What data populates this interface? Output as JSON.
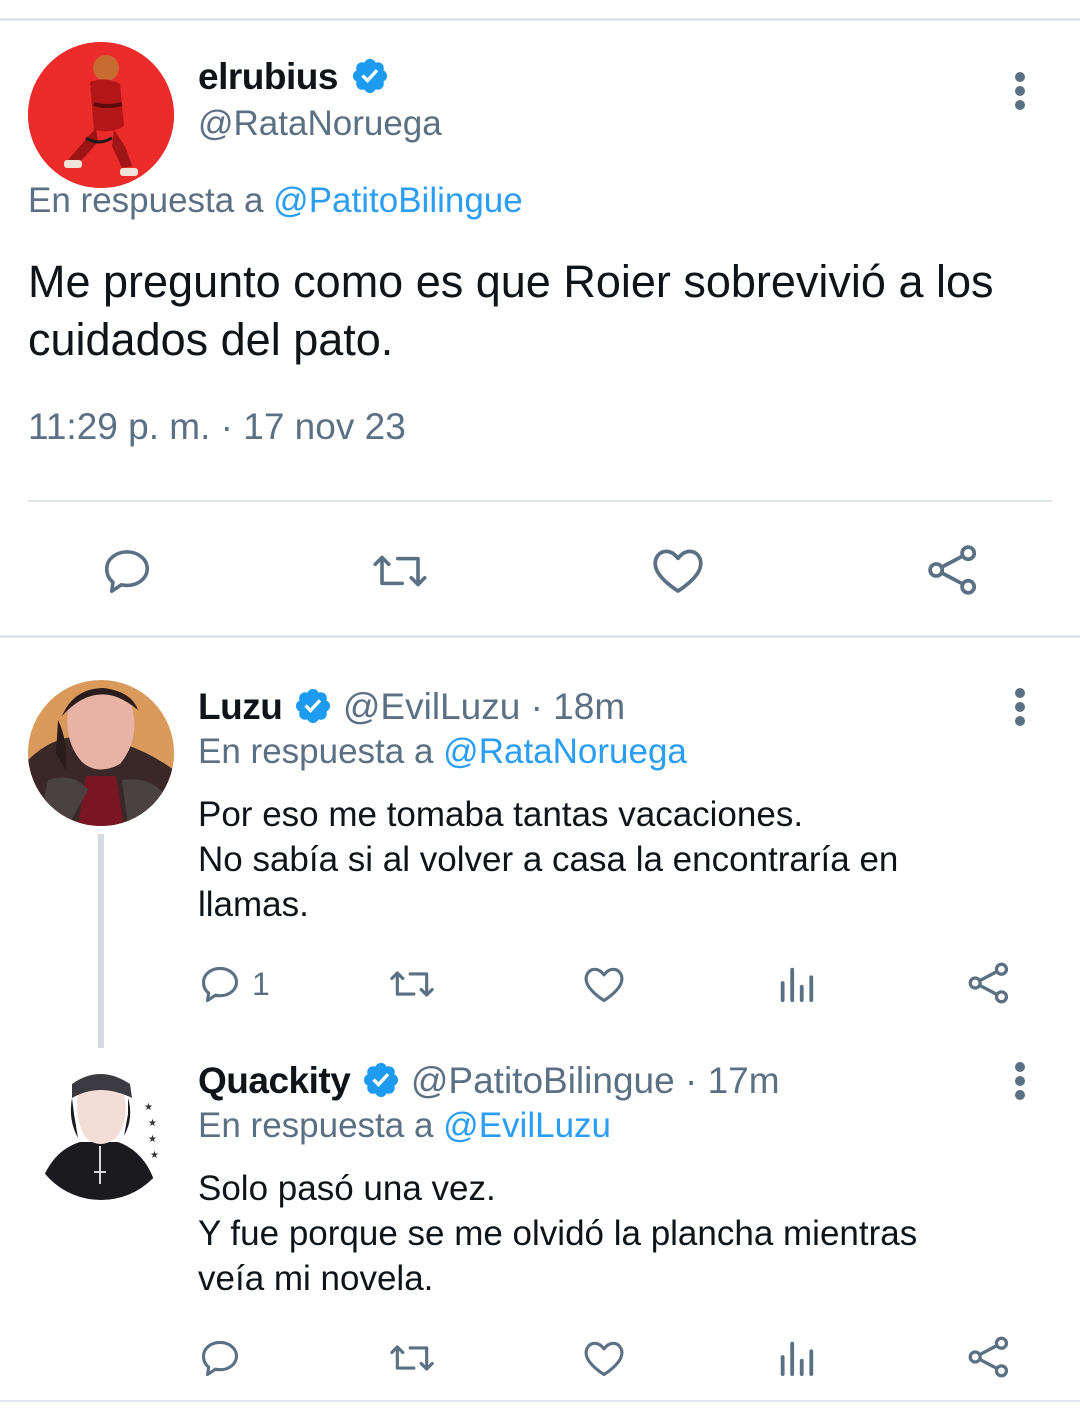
{
  "main_tweet": {
    "author_name": "elrubius",
    "author_handle": "@RataNoruega",
    "reply_prefix": "En respuesta a",
    "reply_mention": "@PatitoBilingue",
    "text": "Me pregunto como es que Roier sobrevivió a los cuidados del pato.",
    "timestamp": "11:29 p. m. · 17 nov 23",
    "actions": [
      "reply-icon",
      "retweet-icon",
      "like-icon",
      "share-icon"
    ]
  },
  "replies": [
    {
      "author_name": "Luzu",
      "author_handle": "@EvilLuzu",
      "age": "· 18m",
      "reply_prefix": "En respuesta a",
      "reply_mention": "@RataNoruega",
      "text_lines": [
        "Por eso me tomaba tantas vacaciones.",
        "No sabía si al volver a casa la encontraría en",
        "llamas."
      ],
      "reply_count": "1"
    },
    {
      "author_name": "Quackity",
      "author_handle": "@PatitoBilingue",
      "age": "· 17m",
      "reply_prefix": "En respuesta a",
      "reply_mention": "@EvilLuzu",
      "text_lines": [
        "Solo pasó una vez.",
        "Y fue porque se me olvidó la plancha mientras",
        "veía mi novela."
      ],
      "reply_count": ""
    }
  ],
  "colors": {
    "accent": "#2a9df4",
    "secondary_text": "#5b7083",
    "divider": "#e1e6ea"
  }
}
